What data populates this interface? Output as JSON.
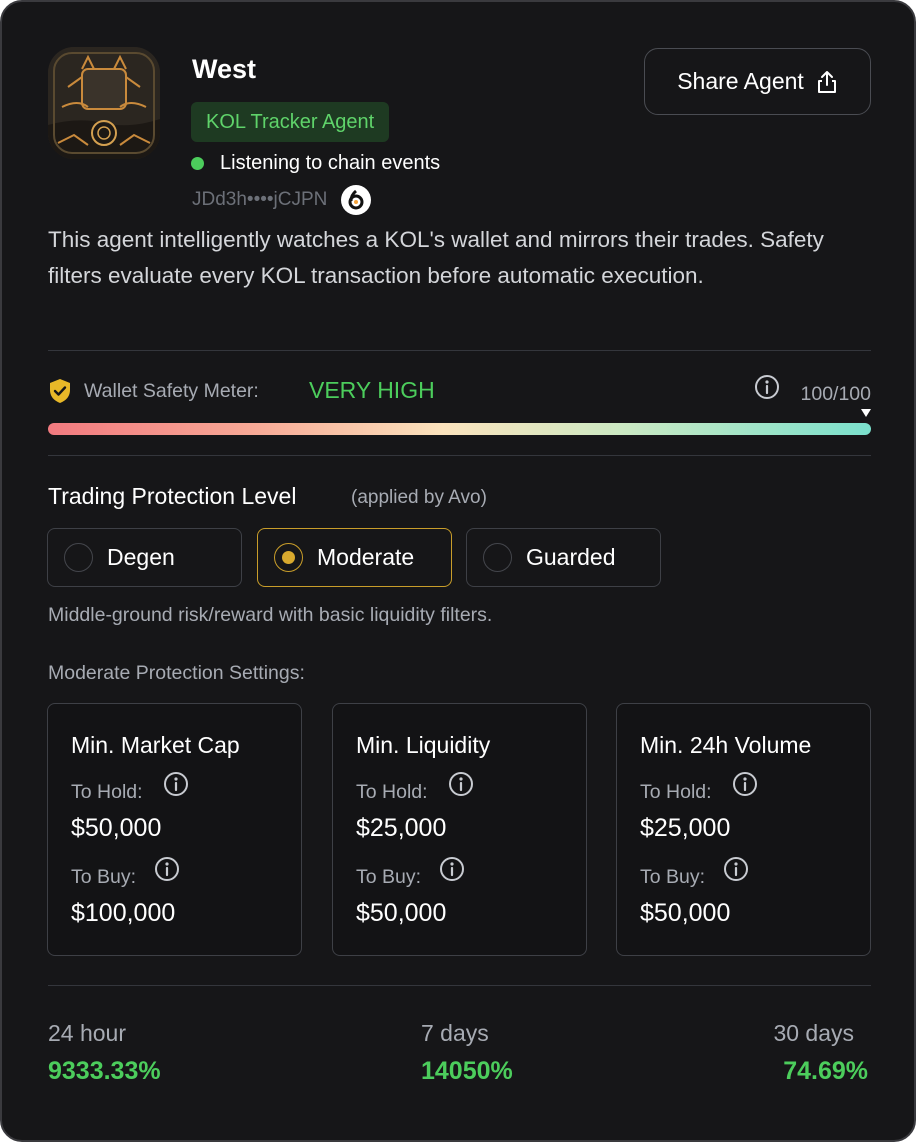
{
  "agent": {
    "name": "West",
    "type_badge": "KOL Tracker Agent",
    "status": "Listening to chain events",
    "address": "JDd3h••••jCJPN",
    "share_label": "Share Agent",
    "description": "This agent intelligently watches a KOL's wallet and mirrors their trades. Safety filters evaluate every KOL transaction before automatic execution."
  },
  "safety": {
    "label": "Wallet Safety Meter:",
    "value": "VERY HIGH",
    "score": "100/100",
    "level_fraction": 1.0
  },
  "protection": {
    "title": "Trading Protection Level",
    "subtitle": "(applied by Avo)",
    "options": [
      {
        "label": "Degen",
        "selected": false
      },
      {
        "label": "Moderate",
        "selected": true
      },
      {
        "label": "Guarded",
        "selected": false
      }
    ],
    "description": "Middle-ground risk/reward with basic liquidity filters.",
    "settings_title": "Moderate Protection Settings:"
  },
  "settings": [
    {
      "title": "Min. Market Cap",
      "hold_label": "To Hold:",
      "hold_value": "$50,000",
      "buy_label": "To Buy:",
      "buy_value": "$100,000"
    },
    {
      "title": "Min. Liquidity",
      "hold_label": "To Hold:",
      "hold_value": "$25,000",
      "buy_label": "To Buy:",
      "buy_value": "$50,000"
    },
    {
      "title": "Min. 24h Volume",
      "hold_label": "To Hold:",
      "hold_value": "$25,000",
      "buy_label": "To Buy:",
      "buy_value": "$50,000"
    }
  ],
  "stats": [
    {
      "label": "24 hour",
      "value": "9333.33%"
    },
    {
      "label": "7 days",
      "value": "14050%"
    },
    {
      "label": "30 days",
      "value": "74.69%"
    }
  ],
  "icons": {
    "avatar": "avatar-image",
    "share": "share-icon",
    "shield": "shield-check-icon",
    "info": "info-icon",
    "chain": "chain-logo-icon",
    "status_dot": "status-dot"
  },
  "colors": {
    "background": "#161618",
    "positive": "#4ccd5c",
    "selected_border": "#c89d2a",
    "badge_bg": "#1e3a22"
  }
}
